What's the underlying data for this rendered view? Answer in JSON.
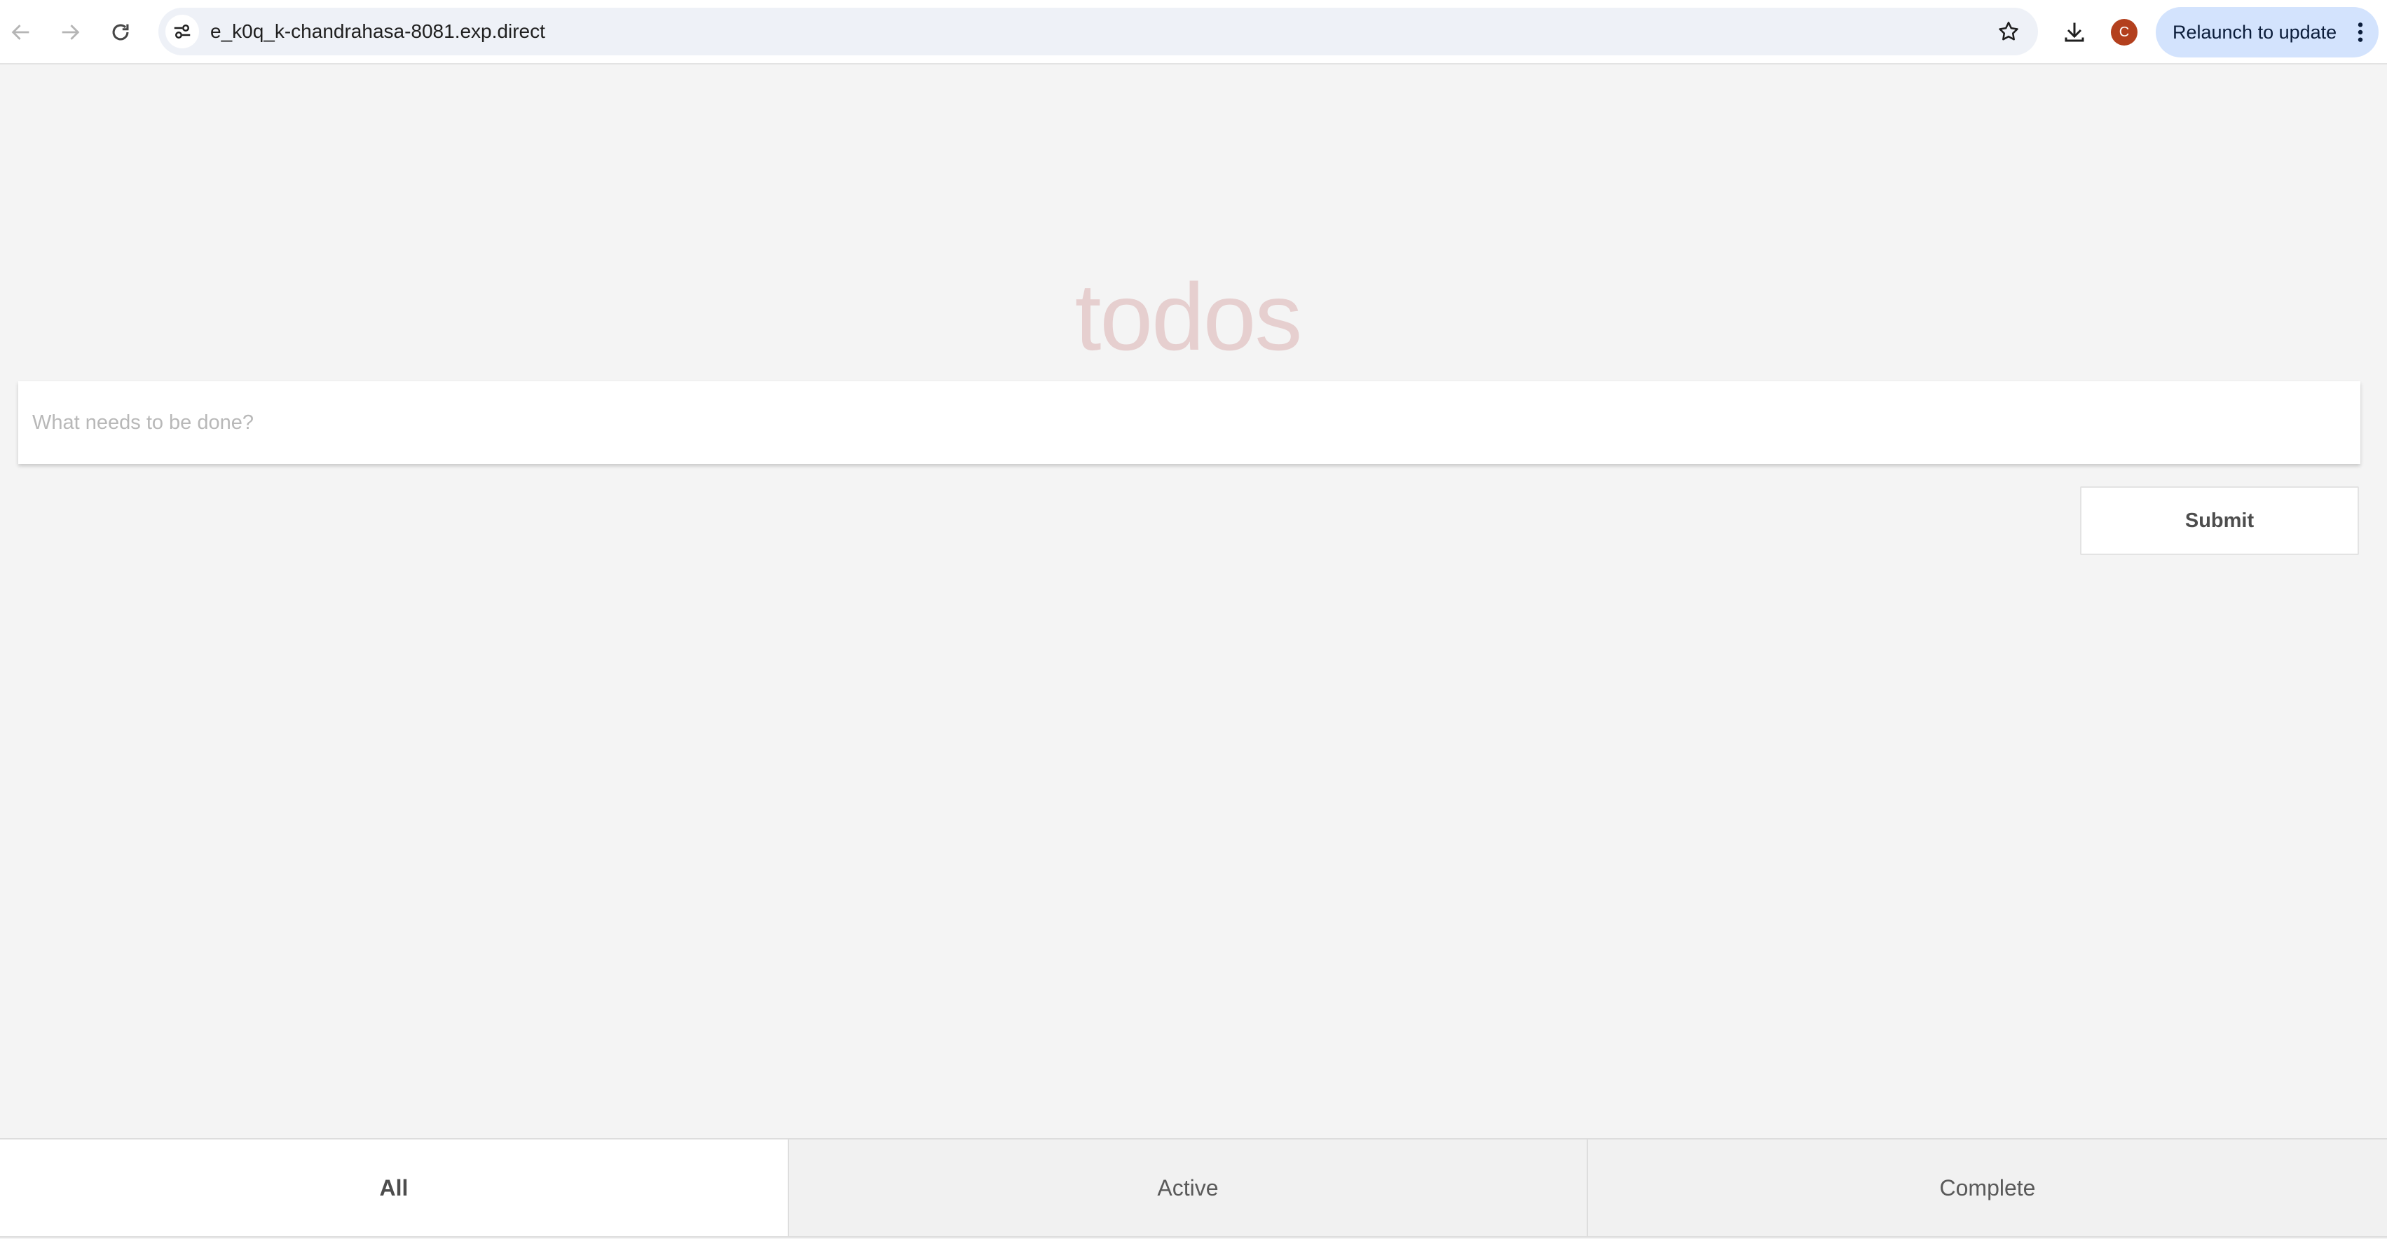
{
  "browser": {
    "url": "e_k0q_k-chandrahasa-8081.exp.direct",
    "profile_initial": "C",
    "relaunch_label": "Relaunch to update",
    "icons": {
      "back": "arrow-left-icon",
      "forward": "arrow-right-icon",
      "reload": "reload-icon",
      "site_info": "tune-icon",
      "bookmark": "star-icon",
      "download": "download-icon",
      "menu": "kebab-icon"
    },
    "colors": {
      "avatar": "#b3401e",
      "relaunch_bg": "#d3e3fd"
    }
  },
  "app": {
    "title": "todos",
    "input": {
      "placeholder": "What needs to be done?",
      "value": ""
    },
    "submit_label": "Submit",
    "filters": [
      {
        "label": "All",
        "selected": true
      },
      {
        "label": "Active",
        "selected": false
      },
      {
        "label": "Complete",
        "selected": false
      }
    ],
    "colors": {
      "title": "#e6cfcf",
      "background": "#f4f4f4"
    }
  }
}
